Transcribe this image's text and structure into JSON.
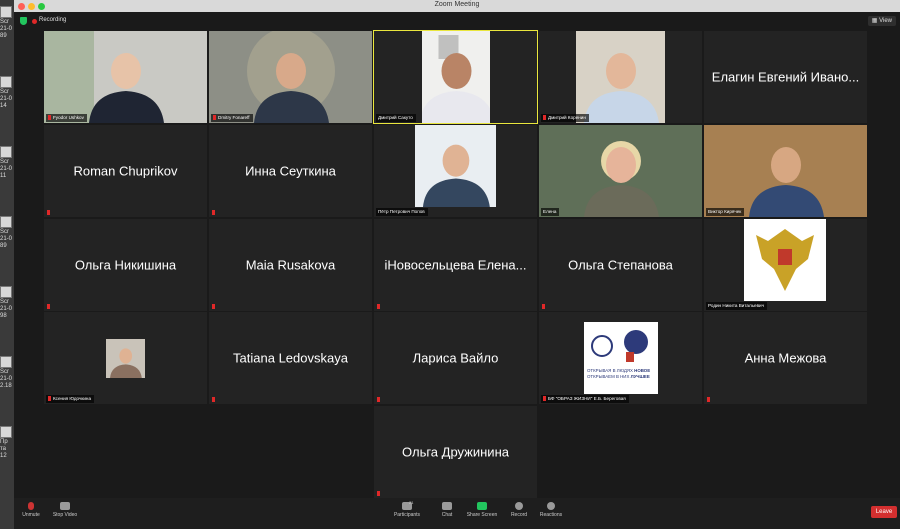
{
  "window": {
    "title": "Zoom Meeting"
  },
  "topbar": {
    "recording": "Recording",
    "view": "View"
  },
  "desktop_files": [
    "Scr",
    "21-0",
    "89",
    "Scr",
    "21-0",
    "14",
    "Scr",
    "21-0",
    "11",
    "Scr",
    "21-0",
    "89",
    "Scr",
    "21-0",
    "98",
    "Scr",
    "21-0",
    "2.18",
    "Пр",
    "та",
    "12"
  ],
  "participants": [
    {
      "label": "Fyodor Ushkov",
      "display": "",
      "kind": "video-man-suit",
      "muted": true
    },
    {
      "label": "Dmitry Fonareff",
      "display": "",
      "kind": "video-man-emblem",
      "muted": true
    },
    {
      "label": "Дмитрий Сакуто",
      "display": "",
      "kind": "video-man-white",
      "muted": false,
      "active": true
    },
    {
      "label": "Дмитрий Коренин",
      "display": "",
      "kind": "video-man-beard",
      "muted": true
    },
    {
      "label": "",
      "display": "Елагин Евгений Ивано...",
      "kind": "name",
      "muted": false
    },
    {
      "label": "",
      "display": "Roman Chuprikov",
      "kind": "name",
      "muted": true
    },
    {
      "label": "",
      "display": "Инна Сеуткина",
      "kind": "name",
      "muted": true
    },
    {
      "label": "Пётр Петрович Попов",
      "display": "",
      "kind": "photo-man-suit",
      "muted": false
    },
    {
      "label": "Елена",
      "display": "",
      "kind": "video-woman",
      "muted": false
    },
    {
      "label": "Виктор Кирячек",
      "display": "",
      "kind": "video-man-shirt",
      "muted": false
    },
    {
      "label": "",
      "display": "Ольга Никишина",
      "kind": "name",
      "muted": true
    },
    {
      "label": "",
      "display": "Maia Rusakova",
      "kind": "name",
      "muted": true
    },
    {
      "label": "",
      "display": "iНовосельцева Елена...",
      "kind": "name",
      "muted": true
    },
    {
      "label": "",
      "display": "Ольга Степанова",
      "kind": "name",
      "muted": true
    },
    {
      "label": "Родин Никита Витальевич",
      "display": "",
      "kind": "emblem",
      "muted": false
    },
    {
      "label": "Ксения Юдочкина",
      "display": "",
      "kind": "thumb-woman",
      "muted": true
    },
    {
      "label": "",
      "display": "Tatiana Ledovskaya",
      "kind": "name",
      "muted": true
    },
    {
      "label": "",
      "display": "Лариса Вайло",
      "kind": "name",
      "muted": true
    },
    {
      "label": "БФ \"ОБРАЗ ЖИЗНИ\" Е.Б. Береговая",
      "display": "",
      "kind": "poster",
      "muted": true
    },
    {
      "label": "",
      "display": "Анна Межова",
      "kind": "name",
      "muted": true
    },
    {
      "label": "",
      "display": "Ольга Дружинина",
      "kind": "name",
      "muted": true
    }
  ],
  "poster": {
    "line1": "ОТКРЫВАЯ В ЛЮДЯХ",
    "word1": "НОВОЕ",
    "line2": "ОТКРЫВАЕМ В НИХ",
    "word2": "ЛУЧШЕЕ"
  },
  "toolbar": {
    "unmute": "Unmute",
    "stop_video": "Stop Video",
    "participants": "Participants",
    "participant_count": "21",
    "chat": "Chat",
    "share_screen": "Share Screen",
    "record": "Record",
    "reactions": "Reactions",
    "leave": "Leave"
  },
  "colors": {
    "accent": "#22c55e",
    "record": "#e02828",
    "leave": "#d32f2f",
    "active_speaker": "#e9e63d",
    "tile": "#232323"
  }
}
